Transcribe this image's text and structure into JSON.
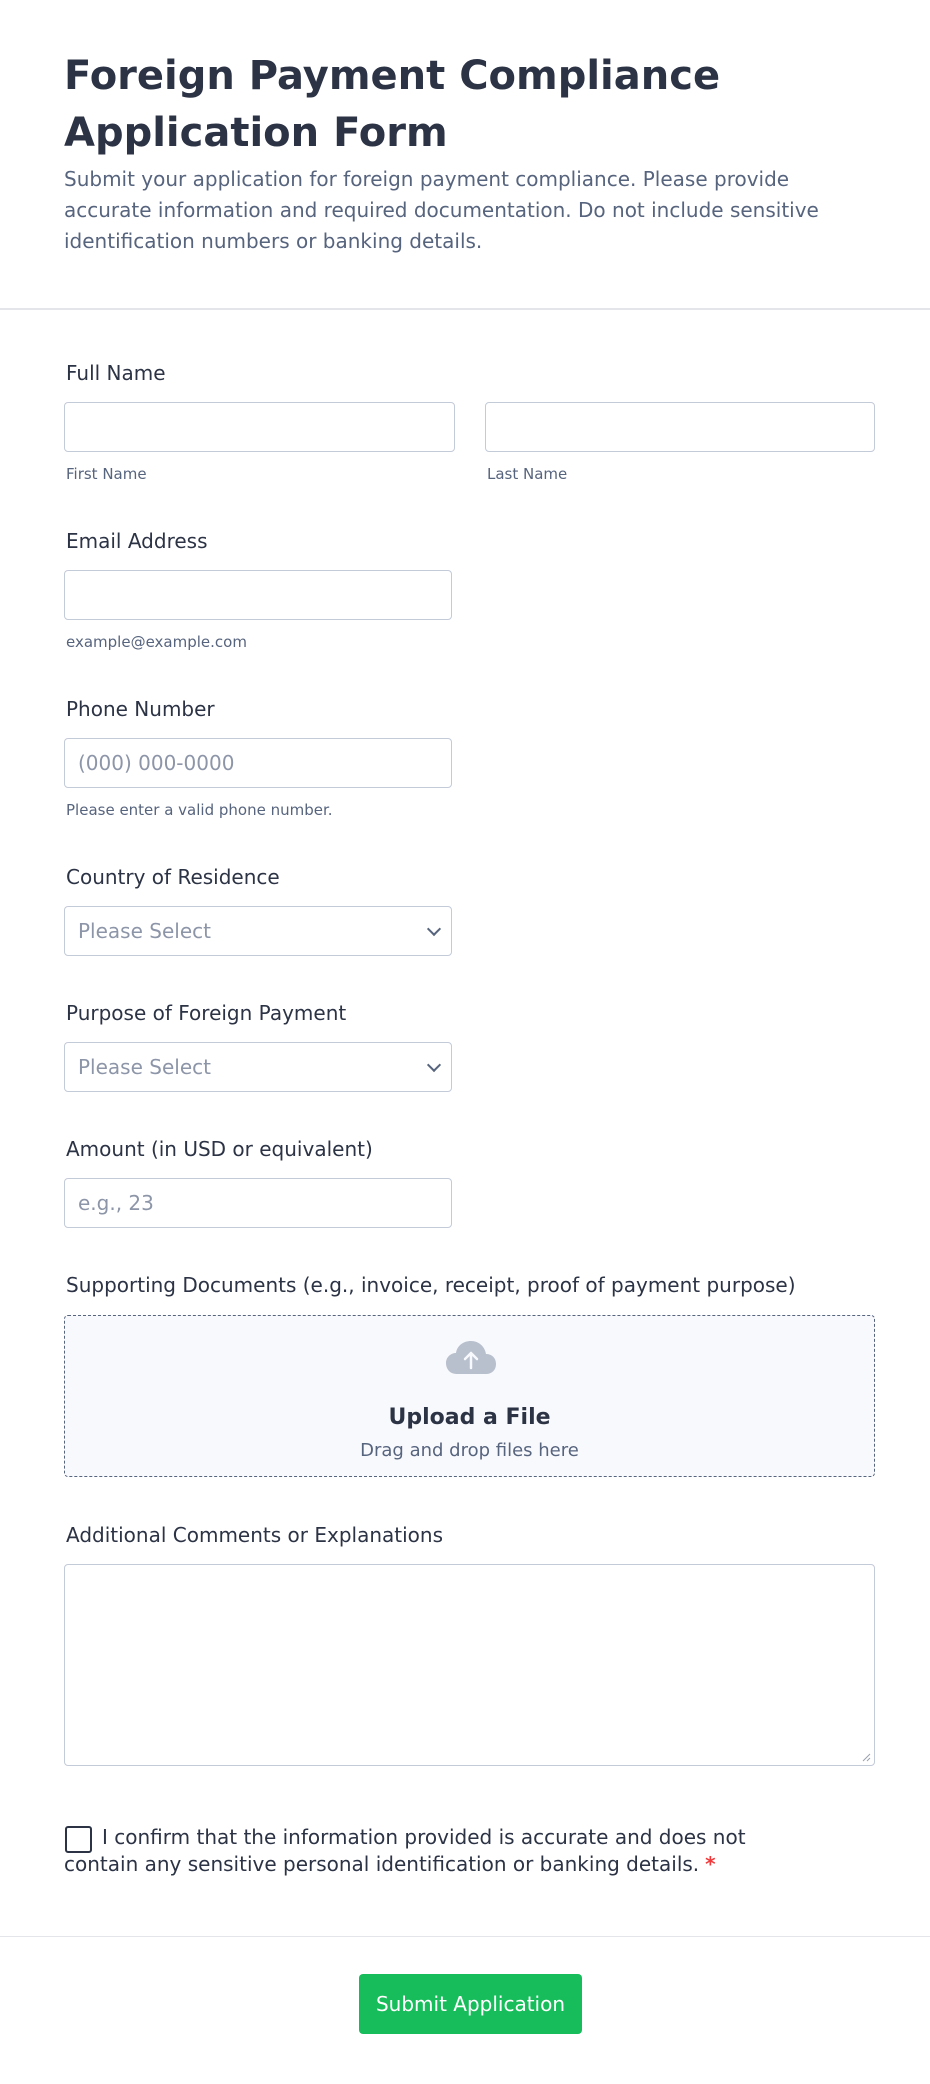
{
  "header": {
    "title": "Foreign Payment Compliance Application Form",
    "description": "Submit your application for foreign payment compliance. Please provide accurate information and required documentation. Do not include sensitive identification numbers or banking details."
  },
  "full_name": {
    "label": "Full Name",
    "first_sublabel": "First Name",
    "last_sublabel": "Last Name",
    "first_value": "",
    "last_value": ""
  },
  "email": {
    "label": "Email Address",
    "value": "",
    "sublabel": "example@example.com"
  },
  "phone": {
    "label": "Phone Number",
    "placeholder": "(000) 000-0000",
    "sublabel": "Please enter a valid phone number."
  },
  "country": {
    "label": "Country of Residence",
    "selected": "Please Select"
  },
  "purpose": {
    "label": "Purpose of Foreign Payment",
    "selected": "Please Select"
  },
  "amount": {
    "label": "Amount (in USD or equivalent)",
    "placeholder": "e.g., 23"
  },
  "documents": {
    "label": "Supporting Documents (e.g., invoice, receipt, proof of payment purpose)",
    "upload_title": "Upload a File",
    "upload_sub": "Drag and drop files here",
    "icon": "cloud-upload-icon"
  },
  "comments": {
    "label": "Additional Comments or Explanations",
    "value": ""
  },
  "confirm": {
    "text": "I confirm that the information provided is accurate and does not contain any sensitive personal identification or banking details.",
    "required_mark": "*",
    "checked": false
  },
  "submit": {
    "label": "Submit Application"
  },
  "colors": {
    "accent": "#18bd5b",
    "required": "#f23a3c",
    "text": "#2c3345",
    "muted": "#57647e"
  }
}
